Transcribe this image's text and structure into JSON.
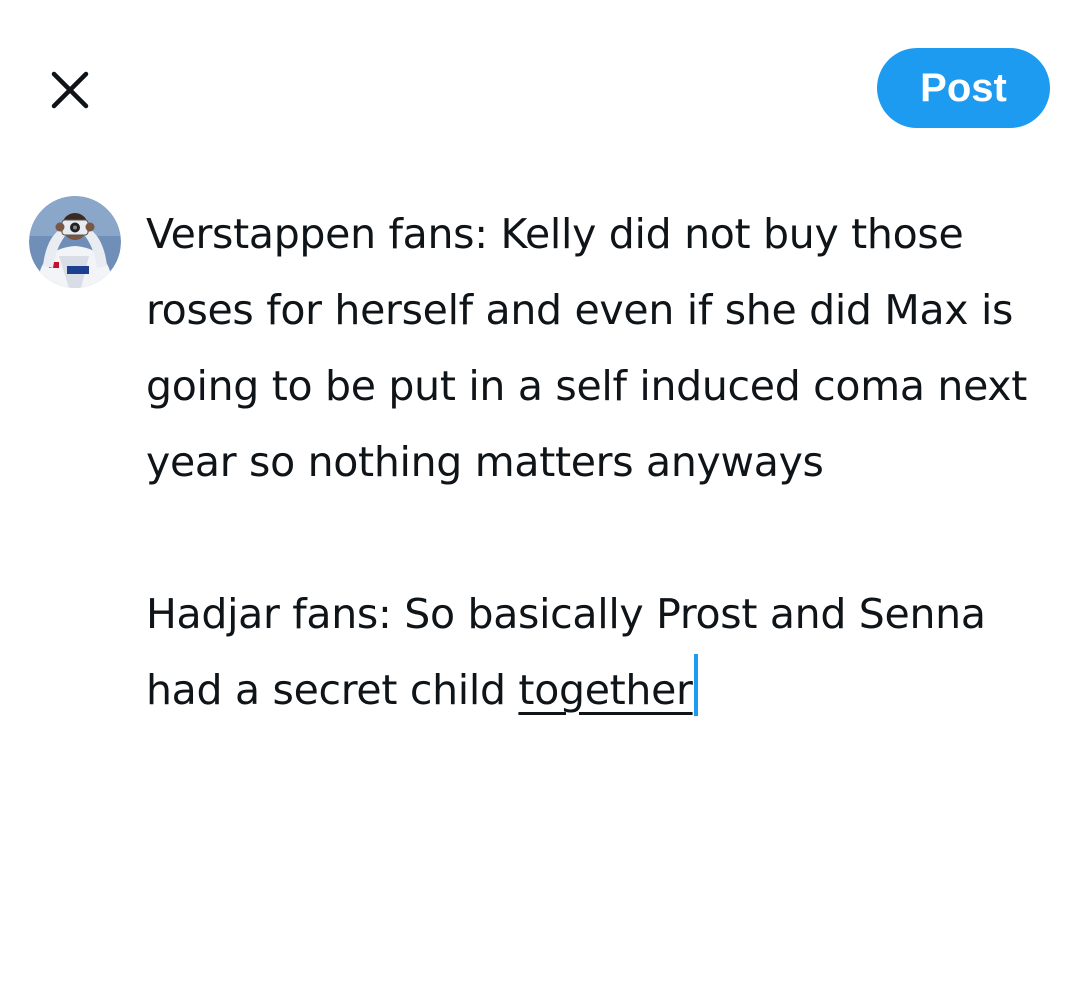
{
  "header": {
    "close_icon": "close-icon",
    "post_label": "Post"
  },
  "colors": {
    "accent": "#1d9bf0",
    "text": "#0f1419"
  },
  "composer": {
    "avatar_icon": "user-avatar",
    "paragraph_1": "Verstappen fans: Kelly did not buy those roses for herself and even if she did Max is going to be put in a self induced coma next year so nothing matters anyways",
    "paragraph_2_start": "Hadjar fans: So basically Prost and Senna had a secret child ",
    "paragraph_2_underlined": "together"
  }
}
